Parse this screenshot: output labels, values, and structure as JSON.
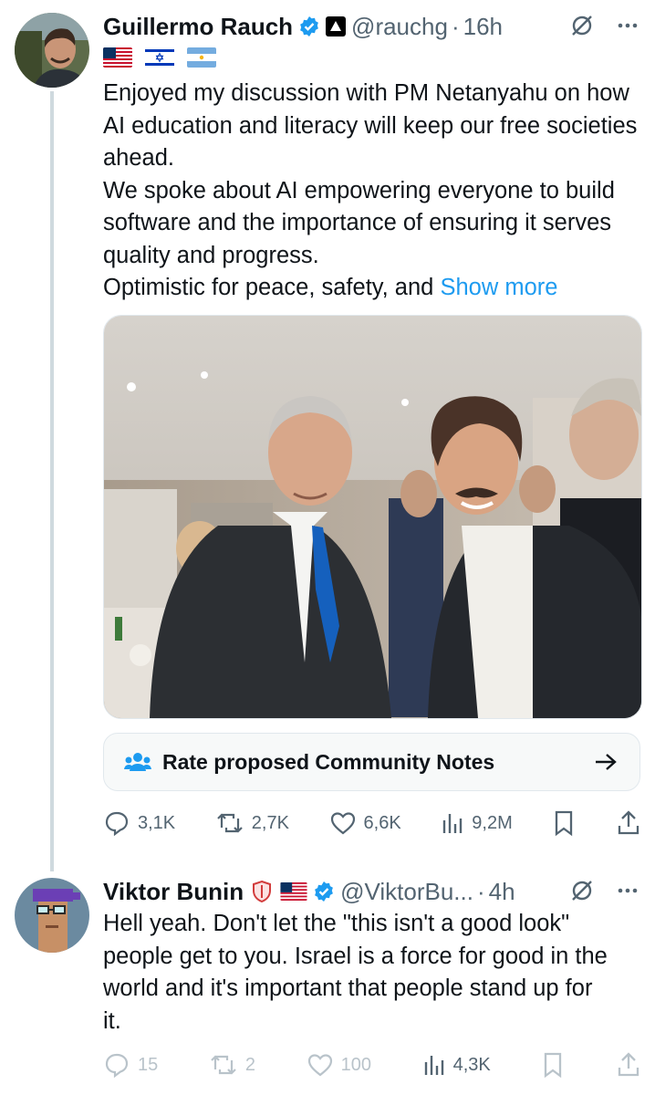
{
  "tweet1": {
    "author_name": "Guillermo Rauch",
    "handle": "@rauchg",
    "separator": "·",
    "time": "16h",
    "flags": [
      "us-flag",
      "israel-flag",
      "argentina-flag"
    ],
    "text_lines": [
      "Enjoyed my discussion with PM Netanyahu on how AI education and literacy will keep our free societies ahead.",
      "We spoke about AI empowering everyone to build software and the importance of ensuring it serves quality and progress.",
      "Optimistic for peace, safety, and "
    ],
    "show_more": "Show more",
    "community_notes": "Rate proposed Community Notes",
    "stats": {
      "replies": "3,1K",
      "reposts": "2,7K",
      "likes": "6,6K",
      "views": "9,2M"
    }
  },
  "tweet2": {
    "author_name": "Viktor Bunin",
    "handle": "@ViktorBu...",
    "separator": "·",
    "time": "4h",
    "text": "Hell yeah. Don't let the \"this isn't a good look\" people get to you. Israel is a force for good in the world and it's important that people stand up for it.",
    "stats": {
      "replies": "15",
      "reposts": "2",
      "likes": "100",
      "views": "4,3K"
    }
  },
  "colors": {
    "accent": "#1d9bf0",
    "secondary_text": "#536471",
    "primary_text": "#0f1419"
  }
}
